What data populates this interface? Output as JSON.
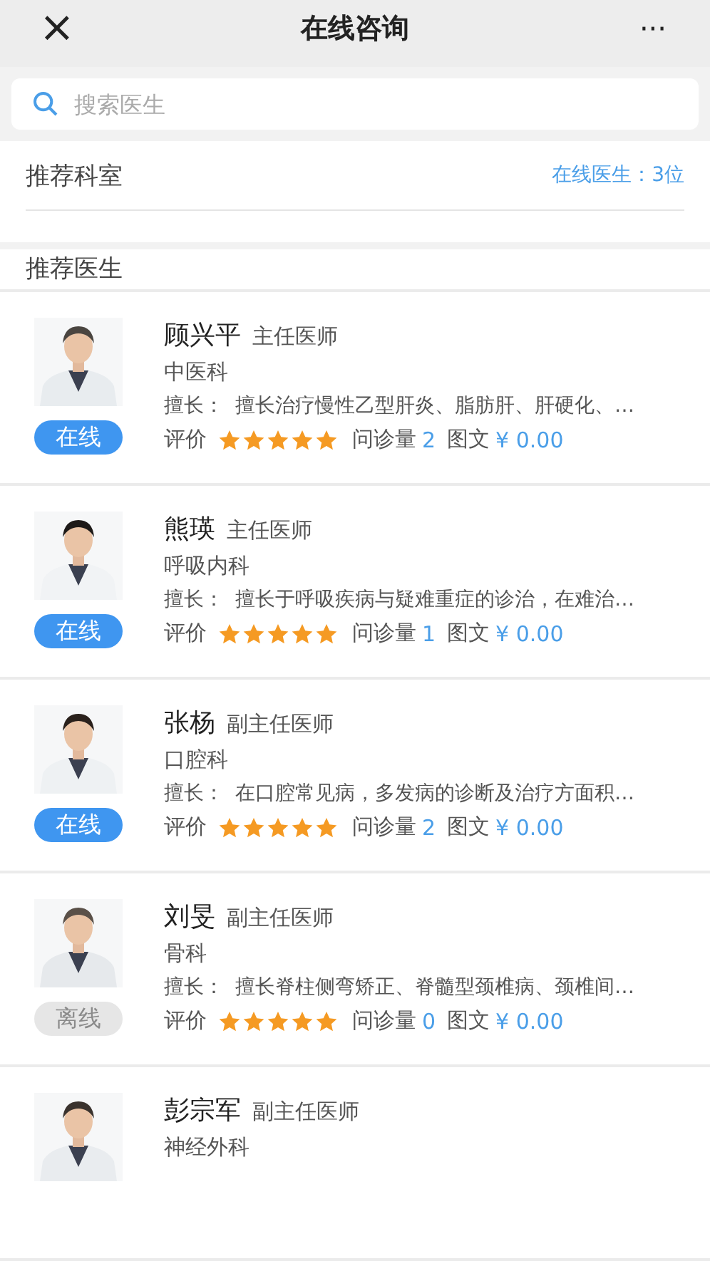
{
  "header": {
    "close": "×",
    "title": "在线咨询",
    "more": "···"
  },
  "search": {
    "placeholder": "搜索医生"
  },
  "departments": {
    "title": "推荐科室",
    "online_count": "在线医生：3位"
  },
  "doctors_section": {
    "title": "推荐医生"
  },
  "doctors": [
    {
      "name": "顾兴平",
      "title": "主任医师",
      "department": "中医科",
      "expertise_label": "擅长：",
      "expertise": "擅长治疗慢性乙型肝炎、脂肪肝、肝硬化、…",
      "online": true,
      "status": "在线",
      "rating_label": "评价",
      "stars": 5,
      "consult_label": "问诊量",
      "consult_count": "2",
      "service": "图文",
      "price": "¥ 0.00"
    },
    {
      "name": "熊瑛",
      "title": "主任医师",
      "department": "呼吸内科",
      "expertise_label": "擅长：",
      "expertise": "擅长于呼吸疾病与疑难重症的诊治，在难治…",
      "online": true,
      "status": "在线",
      "rating_label": "评价",
      "stars": 5,
      "consult_label": "问诊量",
      "consult_count": "1",
      "service": "图文",
      "price": "¥ 0.00"
    },
    {
      "name": "张杨",
      "title": "副主任医师",
      "department": "口腔科",
      "expertise_label": "擅长：",
      "expertise": "在口腔常见病，多发病的诊断及治疗方面积…",
      "online": true,
      "status": "在线",
      "rating_label": "评价",
      "stars": 5,
      "consult_label": "问诊量",
      "consult_count": "2",
      "service": "图文",
      "price": "¥ 0.00"
    },
    {
      "name": "刘旻",
      "title": "副主任医师",
      "department": "骨科",
      "expertise_label": "擅长：",
      "expertise": "擅长脊柱侧弯矫正、脊髓型颈椎病、颈椎间…",
      "online": false,
      "status": "离线",
      "rating_label": "评价",
      "stars": 5,
      "consult_label": "问诊量",
      "consult_count": "0",
      "service": "图文",
      "price": "¥ 0.00"
    },
    {
      "name": "彭宗军",
      "title": "副主任医师",
      "department": "神经外科"
    }
  ]
}
